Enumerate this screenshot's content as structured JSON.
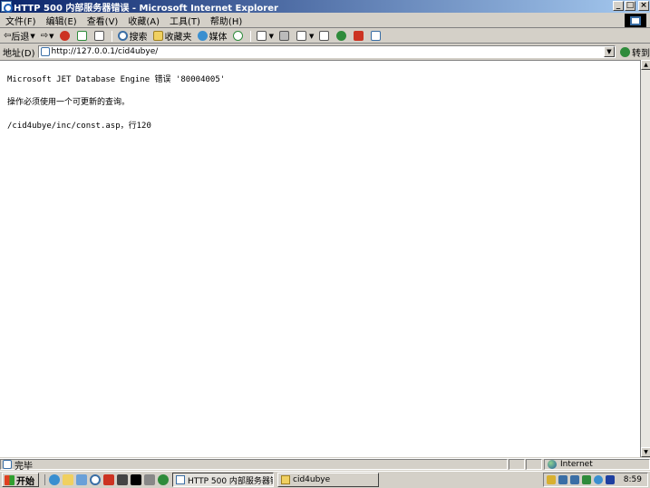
{
  "window": {
    "title": "HTTP 500 内部服务器错误 - Microsoft Internet Explorer",
    "btn_min": "_",
    "btn_max": "□",
    "btn_close": "×"
  },
  "menu": [
    "文件(F)",
    "编辑(E)",
    "查看(V)",
    "收藏(A)",
    "工具(T)",
    "帮助(H)"
  ],
  "toolbar": {
    "back_label": "后退",
    "search_label": "搜索",
    "favorites_label": "收藏夹",
    "media_label": "媒体"
  },
  "address": {
    "label": "地址(D)",
    "url": "http://127.0.0.1/cid4ubye/",
    "go_label": "转到"
  },
  "page": {
    "line1": "Microsoft JET Database Engine 错误 '80004005'",
    "line2": "操作必须使用一个可更新的查询。",
    "line3": "/cid4ubye/inc/const.asp，行120"
  },
  "status": {
    "text": "完毕",
    "zone": "Internet"
  },
  "taskbar": {
    "start_label": "开始",
    "tasks": [
      "HTTP 500 内部服务器错...",
      "cid4ubye"
    ],
    "clock": "8:59"
  },
  "colors": {
    "title_gradient_start": "#0a246a",
    "title_gradient_end": "#a6caf0",
    "chrome": "#d4d0c8"
  }
}
